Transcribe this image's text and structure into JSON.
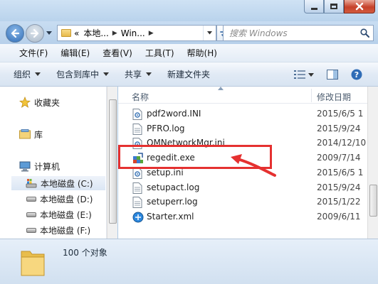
{
  "window": {
    "controls": [
      "minimize",
      "maximize",
      "close"
    ]
  },
  "address": {
    "prefix": "«",
    "crumbs": [
      "本地...",
      "Win..."
    ],
    "search_placeholder": "搜索 Windows"
  },
  "menu": {
    "items": [
      "文件(F)",
      "编辑(E)",
      "查看(V)",
      "工具(T)",
      "帮助(H)"
    ]
  },
  "toolbar": {
    "organize": "组织",
    "include_library": "包含到库中",
    "share": "共享",
    "new_folder": "新建文件夹"
  },
  "nav": {
    "favorites": "收藏夹",
    "library": "库",
    "computer": "计算机",
    "drives": [
      "本地磁盘 (C:)",
      "本地磁盘 (D:)",
      "本地磁盘 (E:)",
      "本地磁盘 (F:)"
    ]
  },
  "columns": {
    "name": "名称",
    "date": "修改日期"
  },
  "files": [
    {
      "name": "pdf2word.INI",
      "date": "2015/6/5 1",
      "icon": "ini-icon"
    },
    {
      "name": "PFRO.log",
      "date": "2015/9/24",
      "icon": "text-file-icon"
    },
    {
      "name": "QMNetworkMgr.ini",
      "date": "2014/12/10",
      "icon": "ini-icon"
    },
    {
      "name": "regedit.exe",
      "date": "2009/7/14",
      "icon": "regedit-icon"
    },
    {
      "name": "setup.ini",
      "date": "2015/6/5 1",
      "icon": "ini-icon"
    },
    {
      "name": "setupact.log",
      "date": "2015/9/24",
      "icon": "text-file-icon"
    },
    {
      "name": "setuperr.log",
      "date": "2015/1/22",
      "icon": "text-file-icon"
    },
    {
      "name": "Starter.xml",
      "date": "2009/6/11",
      "icon": "xml-icon"
    }
  ],
  "status": {
    "count": "100 个对象"
  },
  "colors": {
    "highlight": "#e53130"
  }
}
